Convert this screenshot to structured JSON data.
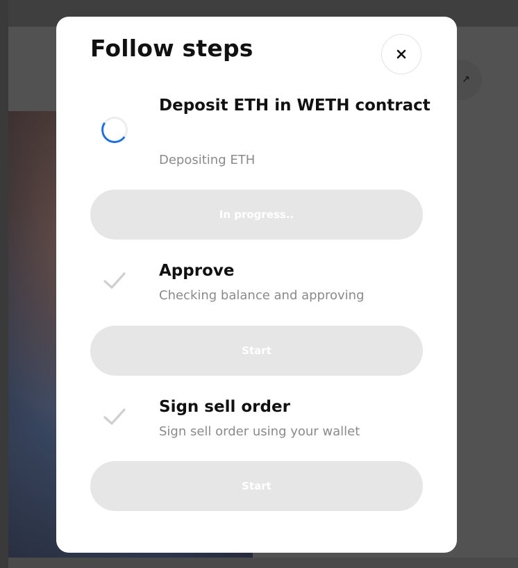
{
  "modal": {
    "title": "Follow steps",
    "close_icon": "close-icon"
  },
  "steps": [
    {
      "title": "Deposit ETH in WETH contract",
      "description": "Depositing ETH",
      "icon": "spinner-icon",
      "status": "in-progress",
      "button_label": "In progress.."
    },
    {
      "title": "Approve",
      "description": "Checking balance and approving",
      "icon": "checkmark-icon",
      "status": "pending",
      "button_label": "Start"
    },
    {
      "title": "Sign sell order",
      "description": "Sign sell order using your wallet",
      "icon": "checkmark-icon",
      "status": "pending",
      "button_label": "Start"
    }
  ],
  "colors": {
    "accent": "#1d6fe8",
    "button_disabled_bg": "#e6e6e6",
    "muted_text": "#8a8a8a"
  }
}
